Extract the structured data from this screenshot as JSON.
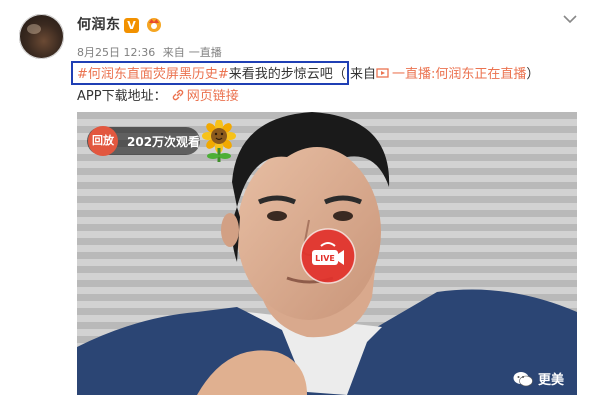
{
  "post": {
    "author": "何润东",
    "verified_mark": "V",
    "date": "8月25日 12:36",
    "source_prefix": "来自",
    "source_app": "一直播",
    "topic": "#何润东直面荧屏黑历史#",
    "text_after_topic": " 来看我的步惊云吧",
    "paren_open": "（ 来自 ",
    "live_link": "一直播:何润东正在直播",
    "paren_close": " ）",
    "download_label": "APP下载地址：",
    "web_link": "网页链接"
  },
  "video": {
    "replay_label": "回放",
    "view_count": "202万次观看",
    "live_label": "LIVE"
  },
  "watermark": "更美",
  "colors": {
    "accent_orange": "#eb7350",
    "highlight_box": "#1f3fb4",
    "live_red": "#e2312b",
    "replay_red": "#e2573f"
  },
  "icons": [
    "avatar",
    "verified-v-icon",
    "crown-badge-icon",
    "chevron-down-icon",
    "web-link-icon",
    "sunflower-icon",
    "live-camera-icon",
    "wechat-icon"
  ]
}
